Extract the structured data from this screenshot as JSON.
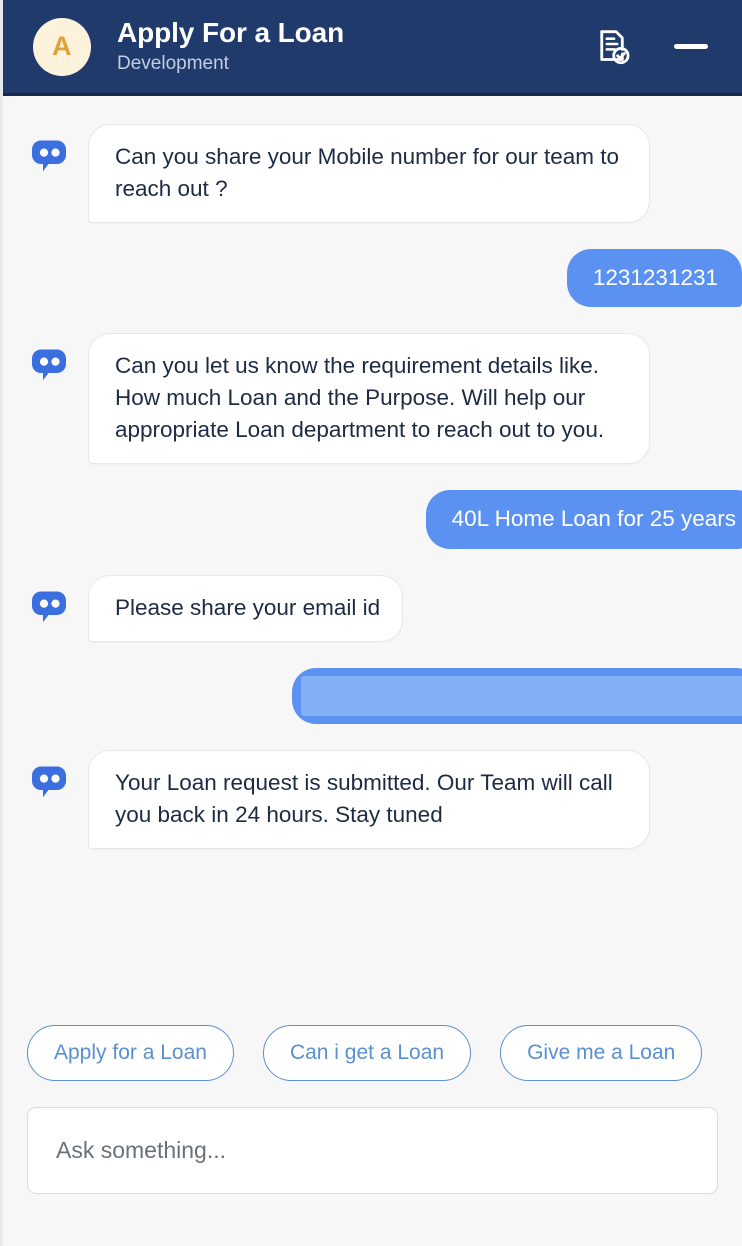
{
  "header": {
    "avatar_initial": "A",
    "title": "Apply For a Loan",
    "subtitle": "Development",
    "transcript_icon": "document-check-icon",
    "minimize_icon": "minimize-icon",
    "background_color": "#1f3a6b",
    "avatar_bg_color": "#fdf3dd",
    "avatar_text_color": "#e0a33a"
  },
  "theme": {
    "chat_background": "#f7f7f8",
    "user_bubble_color": "#5b92f2",
    "bot_bubble_color": "#ffffff",
    "bot_text_color": "#1e2a44",
    "chip_accent_color": "#5a8fd0"
  },
  "messages": [
    {
      "id": "m1",
      "sender": "bot",
      "text": "Can you share your Mobile number for our team to reach out ?",
      "avatar_icon": "chat-bot-icon"
    },
    {
      "id": "m2",
      "sender": "user",
      "text": "1231231231"
    },
    {
      "id": "m3",
      "sender": "bot",
      "text": "Can you let us know the requirement details like. How much Loan and the Purpose. Will help our appropriate Loan department to reach out to you.",
      "avatar_icon": "chat-bot-icon"
    },
    {
      "id": "m4",
      "sender": "user",
      "text": "40L Home Loan for 25 years"
    },
    {
      "id": "m5",
      "sender": "bot",
      "text": "Please share your email id",
      "avatar_icon": "chat-bot-icon"
    },
    {
      "id": "m6",
      "sender": "user",
      "text": "",
      "redacted": true
    },
    {
      "id": "m7",
      "sender": "bot",
      "text": "Your Loan request is submitted. Our Team will call you back in 24 hours. Stay tuned",
      "avatar_icon": "chat-bot-icon"
    }
  ],
  "quick_replies": [
    {
      "label": "Apply for a Loan"
    },
    {
      "label": "Can i get a Loan"
    },
    {
      "label": "Give me a Loan"
    }
  ],
  "composer": {
    "placeholder": "Ask something...",
    "value": ""
  }
}
